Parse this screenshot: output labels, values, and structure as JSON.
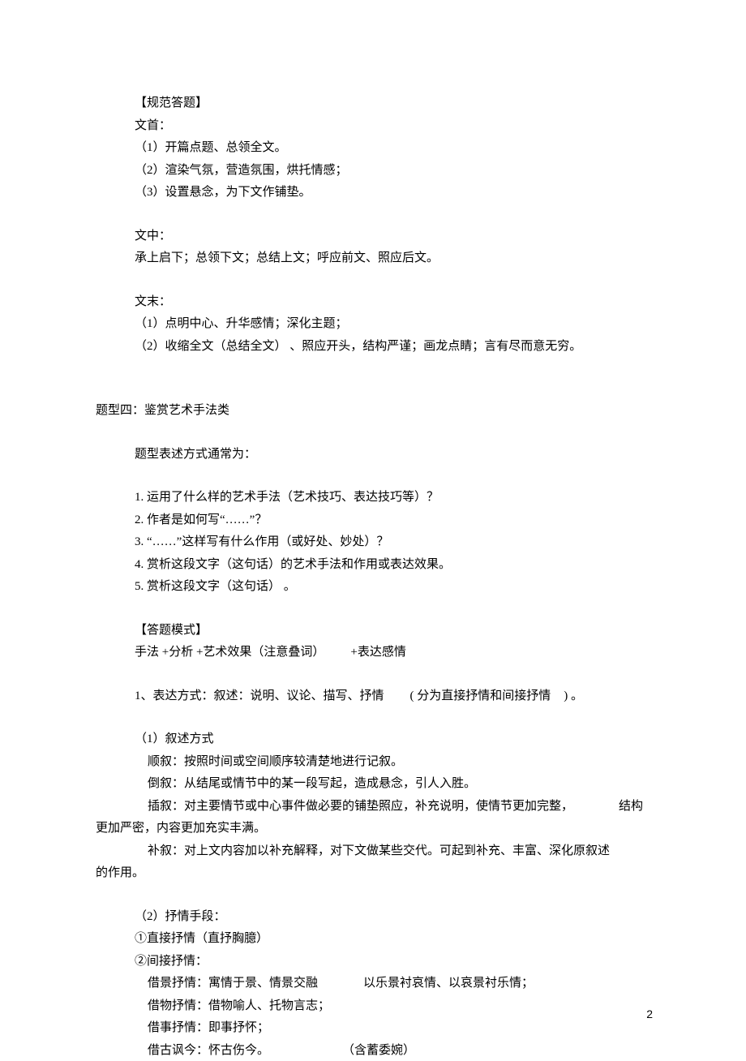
{
  "block1": {
    "heading": "【规范答题】",
    "wenshou_label": "文首：",
    "wenshou_1": "（1）开篇点题、总领全文。",
    "wenshou_2": "（2）渲染气氛，营造氛围，烘托情感；",
    "wenshou_3": "（3）设置悬念，为下文作铺垫。",
    "wenzhong_label": "文中：",
    "wenzhong_1": "承上启下；总领下文；总结上文；呼应前文、照应后文。",
    "wenwei_label": "文末：",
    "wenwei_1": "（1）点明中心、升华感情；深化主题；",
    "wenwei_2": "（2）收缩全文（总结全文）   、照应开头，结构严谨；画龙点睛；言有尽而意无穷。"
  },
  "block2": {
    "title": "题型四：鉴赏艺术手法类",
    "sub": "题型表述方式通常为：",
    "q1": "1. 运用了什么样的艺术手法（艺术技巧、表达技巧等）？",
    "q2": "2. 作者是如何写“……”？",
    "q3": "3. “……”这样写有什么作用（或好处、妙处）？",
    "q4": "4. 赏析这段文字（这句话）的艺术手法和作用或表达效果。",
    "q5": "5. 赏析这段文字（这句话）   。"
  },
  "block3": {
    "heading": "【答题模式】",
    "line1a": "手法 +分析 +艺术效果（注意叠词）",
    "line1b": "+表达感情",
    "line2a": "1、表达方式：叙述：说明、议论、描写、抒情",
    "line2b": "( 分为直接抒情和间接抒情",
    "line2c": ") 。"
  },
  "block4": {
    "heading": "（1）叙述方式",
    "shunxu": "顺叙：按照时间或空间顺序较清楚地进行记叙。",
    "daoxu": "倒叙：从结尾或情节中的某一段写起，造成悬念，引人入胜。",
    "chaxu_a": "插叙：对主要情节或中心事件做必要的铺垫照应，补充说明，使情节更加完整，",
    "chaxu_b": "结构",
    "chaxu_c": "更加严密，内容更加充实丰满。",
    "buxu_a": "补叙：对上文内容加以补充解释，对下文做某些交代。可起到补充、丰富、深化原叙述",
    "buxu_b": "的作用。"
  },
  "block5": {
    "heading": "（2）抒情手段：",
    "zhijie": "①直接抒情（直抒胸臆）",
    "jianjie": "②间接抒情：",
    "jiejing_a": "借景抒情：寓情于景、情景交融",
    "jiejing_b": "以乐景衬哀情、以哀景衬乐情；",
    "jiewu": "借物抒情：借物喻人、托物言志；",
    "jieshi": "借事抒情：即事抒怀；",
    "jiegu_a": "借古讽今：怀古伤今。",
    "jiegu_b": "（含蓄委婉）"
  },
  "page_number": "2"
}
